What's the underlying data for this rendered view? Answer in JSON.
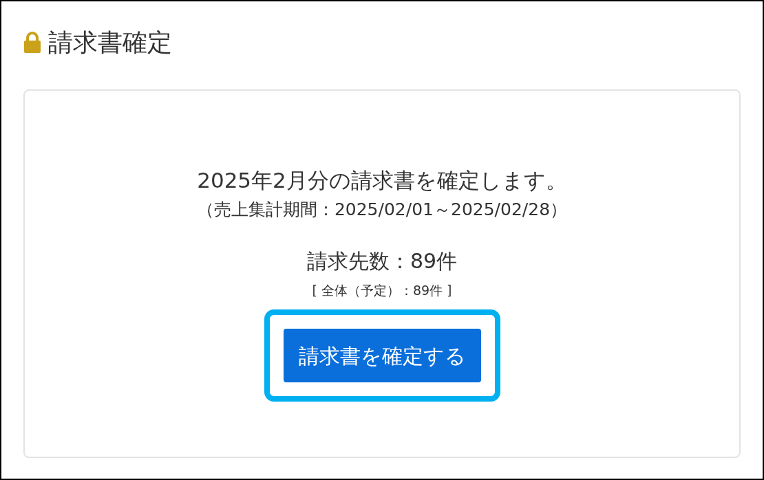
{
  "title": "請求書確定",
  "card": {
    "message": "2025年2月分の請求書を確定します。",
    "period": "（売上集計期間：2025/02/01～2025/02/28）",
    "count": "請求先数：89件",
    "total": "[ 全体（予定）：89件 ]",
    "button": {
      "label": "請求書を確定する",
      "highlighted": true
    }
  }
}
